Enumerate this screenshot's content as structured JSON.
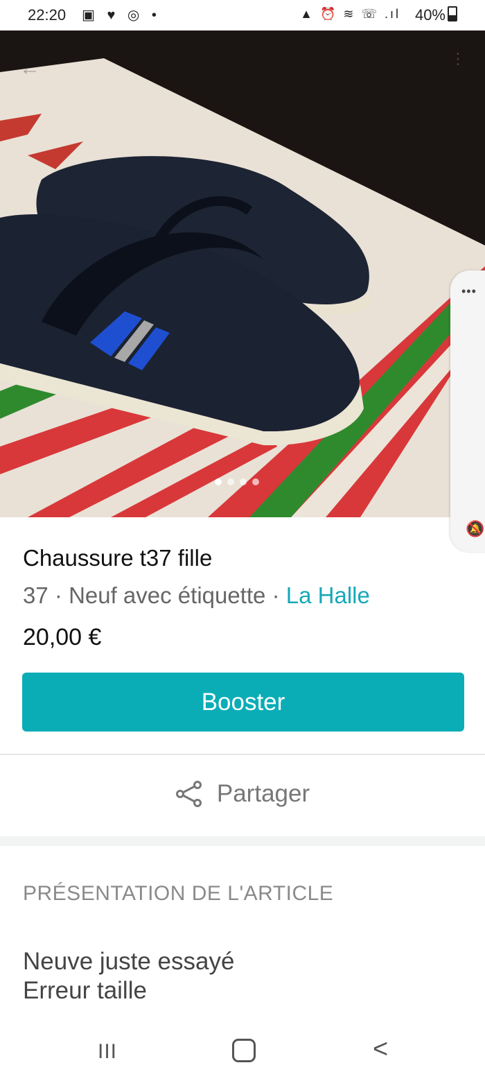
{
  "status_bar": {
    "time": "22:20",
    "left_icons": "▣ ♥ ◎ •",
    "right_icons": "▲ ⏰ ≋ ☏ .ıl",
    "battery": "40%"
  },
  "listing": {
    "photo_count": 4,
    "active_photo_index": 0,
    "title": "Chaussure t37 fille",
    "size": "37",
    "separator": "·",
    "condition": "Neuf avec étiquette",
    "brand": "La Halle",
    "price": "20,00 €"
  },
  "actions": {
    "booster_label": "Booster",
    "share_label": "Partager"
  },
  "description": {
    "section_title": "PRÉSENTATION DE L'ARTICLE",
    "line1": "Neuve juste essayé",
    "line2": "Erreur taille"
  },
  "overlay": {
    "more": "•••",
    "mute": "🔕"
  },
  "nav": {
    "recents": "III",
    "back": "<"
  },
  "colors": {
    "accent": "#0aadb6",
    "brand_link": "#17a8b8"
  }
}
